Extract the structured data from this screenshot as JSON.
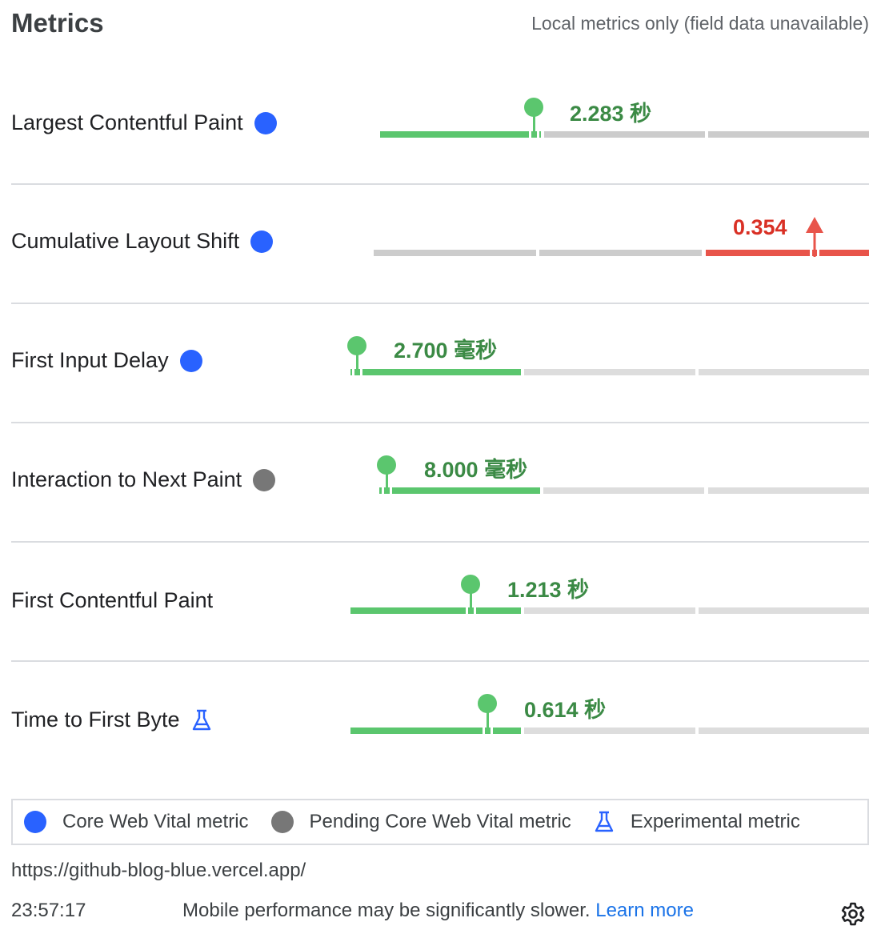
{
  "header": {
    "title": "Metrics",
    "subtitle": "Local metrics only (field data unavailable)"
  },
  "metrics": [
    {
      "name": "Largest Contentful Paint",
      "badge": "core",
      "value": "2.283 秒",
      "rating": "good"
    },
    {
      "name": "Cumulative Layout Shift",
      "badge": "core",
      "value": "0.354",
      "rating": "poor"
    },
    {
      "name": "First Input Delay",
      "badge": "core",
      "value": "2.700 毫秒",
      "rating": "good"
    },
    {
      "name": "Interaction to Next Paint",
      "badge": "pending",
      "value": "8.000 毫秒",
      "rating": "good"
    },
    {
      "name": "First Contentful Paint",
      "badge": "none",
      "value": "1.213 秒",
      "rating": "good"
    },
    {
      "name": "Time to First Byte",
      "badge": "experimental",
      "value": "0.614 秒",
      "rating": "good"
    }
  ],
  "legend": {
    "core": "Core Web Vital metric",
    "pending": "Pending Core Web Vital metric",
    "experimental": "Experimental metric"
  },
  "footer": {
    "url": "https://github-blog-blue.vercel.app/",
    "time": "23:57:17",
    "note": "Mobile performance may be significantly slower.",
    "learn_more": "Learn more"
  },
  "colors": {
    "good": "#3b8a45",
    "good_bar": "#5bc66e",
    "poor": "#d93025",
    "poor_bar": "#e8544a",
    "core_badge": "#2962ff",
    "pending_badge": "#777777"
  },
  "icons": {
    "core": "blue-dot-icon",
    "pending": "grey-dot-icon",
    "experimental": "flask-icon",
    "settings": "gear-icon"
  }
}
